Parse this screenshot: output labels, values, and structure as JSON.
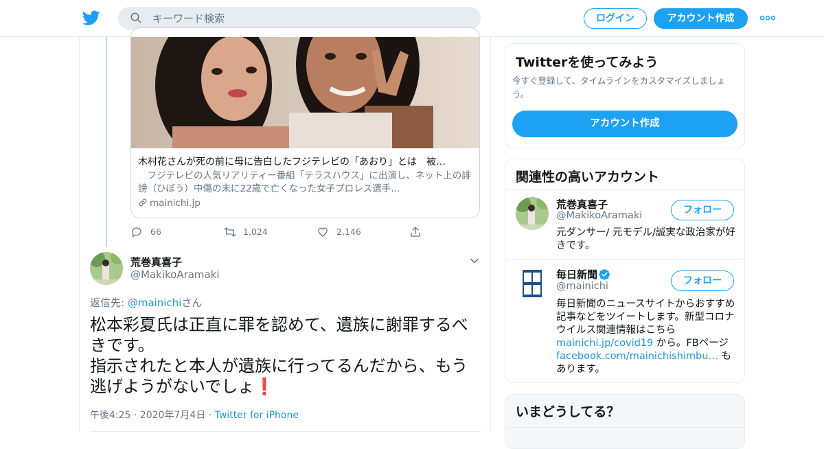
{
  "header": {
    "search_placeholder": "キーワード検索",
    "login_label": "ログイン",
    "signup_label": "アカウント作成",
    "brand_color": "#1da1f2"
  },
  "quoted_card": {
    "title": "木村花さんが死の前に母に告白したフジテレビの「あおり」とは　被…",
    "description": "　フジテレビの人気リアリティー番組「テラスハウス」に出演し、ネット上の誹謗（ひぼう）中傷の末に22歳で亡くなった女子プロレス選手…",
    "domain": "mainichi.jp"
  },
  "parent_actions": {
    "replies": "66",
    "retweets": "1,024",
    "likes": "2,146"
  },
  "tweet": {
    "author_name": "荒巻真喜子",
    "author_handle": "@MakikoAramaki",
    "reply_prefix": "返信先: ",
    "reply_mention": "@mainichi",
    "reply_suffix": "さん",
    "text_line1": "松本彩夏氏は正直に罪を認めて、遺族に謝罪するべきです。",
    "text_line2": "指示されたと本人が遺族に行ってるんだから、もう逃げようがないでしょ",
    "emoji": "❗",
    "time": "午後4:25",
    "date": "2020年7月4日",
    "source": "Twitter for iPhone"
  },
  "sidebar": {
    "try_title": "Twitterを使ってみよう",
    "try_sub": "今すぐ登録して、タイムラインをカスタマイズしましょう。",
    "try_cta": "アカウント作成",
    "related_title": "関連性の高いアカウント",
    "follow_label": "フォロー",
    "accounts": [
      {
        "name": "荒巻真喜子",
        "handle": "@MakikoAramaki",
        "bio": "元ダンサー/ 元モデル/誠実な政治家が好きです。"
      },
      {
        "name": "毎日新聞",
        "handle": "@mainichi",
        "bio_1": "毎日新聞のニュースサイトからおすすめ記事などをツイートします。新型コロナウイルス関連情報はこちら",
        "bio_link1": "mainichi.jp/covid19",
        "bio_2": " から。FBページ",
        "bio_link2": "facebook.com/mainichishimbu…",
        "bio_3": " もあります。"
      }
    ],
    "now_title": "いまどうしてる？"
  }
}
